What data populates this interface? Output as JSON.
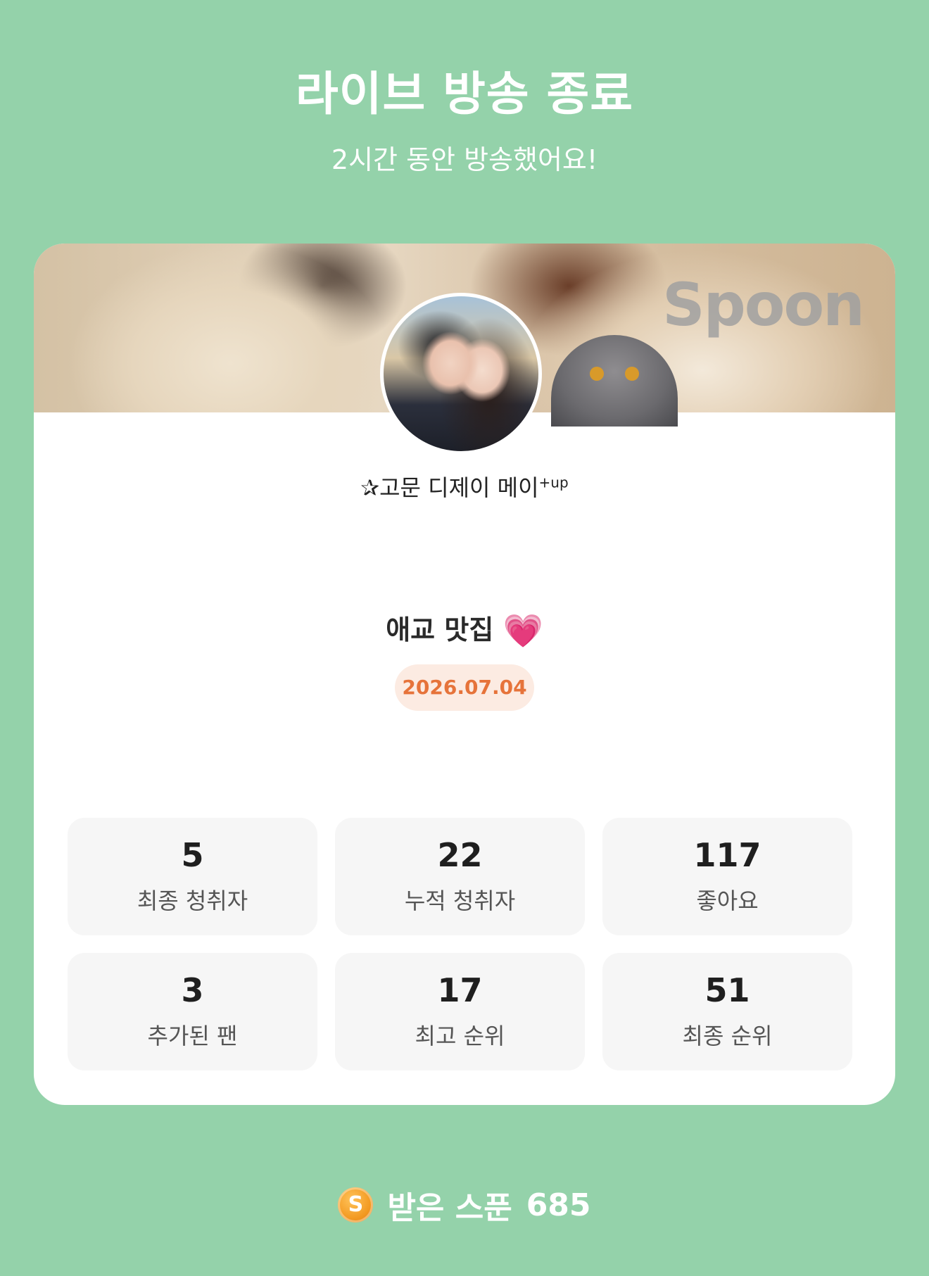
{
  "header": {
    "title": "라이브 방송 종료",
    "subtitle": "2시간 동안 방송했어요!"
  },
  "card": {
    "brand": "Spoon",
    "dj_name": "✰고문 디제이 메이",
    "dj_suffix": "+up",
    "show_title": "애교 맛집",
    "show_emoji": "💗",
    "date": "2026.07.04"
  },
  "stats": [
    {
      "value": "5",
      "label": "최종 청취자"
    },
    {
      "value": "22",
      "label": "누적 청취자"
    },
    {
      "value": "117",
      "label": "좋아요"
    },
    {
      "value": "3",
      "label": "추가된 팬"
    },
    {
      "value": "17",
      "label": "최고 순위"
    },
    {
      "value": "51",
      "label": "최종 순위"
    }
  ],
  "footer": {
    "coin_symbol": "S",
    "label": "받은 스푼",
    "count": "685"
  },
  "colors": {
    "background": "#94d2aa",
    "date_text": "#e6733a",
    "date_bg": "#fcebe2",
    "heart": "#e94cb3"
  }
}
